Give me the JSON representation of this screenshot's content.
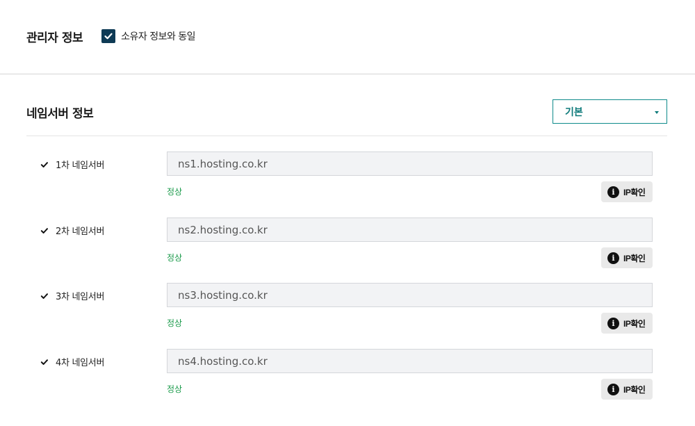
{
  "admin": {
    "title": "관리자 정보",
    "same_as_owner_label": "소유자 정보와 동일",
    "same_as_owner_checked": true
  },
  "nameserver": {
    "title": "네임서버 정보",
    "preset_selected": "기본",
    "items": [
      {
        "label": "1차 네임서버",
        "value": "ns1.hosting.co.kr",
        "status": "정상",
        "ip_check_label": "IP확인"
      },
      {
        "label": "2차 네임서버",
        "value": "ns2.hosting.co.kr",
        "status": "정상",
        "ip_check_label": "IP확인"
      },
      {
        "label": "3차 네임서버",
        "value": "ns3.hosting.co.kr",
        "status": "정상",
        "ip_check_label": "IP확인"
      },
      {
        "label": "4차 네임서버",
        "value": "ns4.hosting.co.kr",
        "status": "정상",
        "ip_check_label": "IP확인"
      }
    ]
  },
  "colors": {
    "checkbox_fill": "#0e3a55",
    "accent_teal": "#0d8a8a",
    "status_ok": "#1a9a4a",
    "input_bg": "#f2f3f5"
  },
  "icons": {
    "checkbox": "checkmark-icon",
    "row_check": "check-icon",
    "info": "info-icon",
    "dropdown": "caret-down-icon"
  }
}
